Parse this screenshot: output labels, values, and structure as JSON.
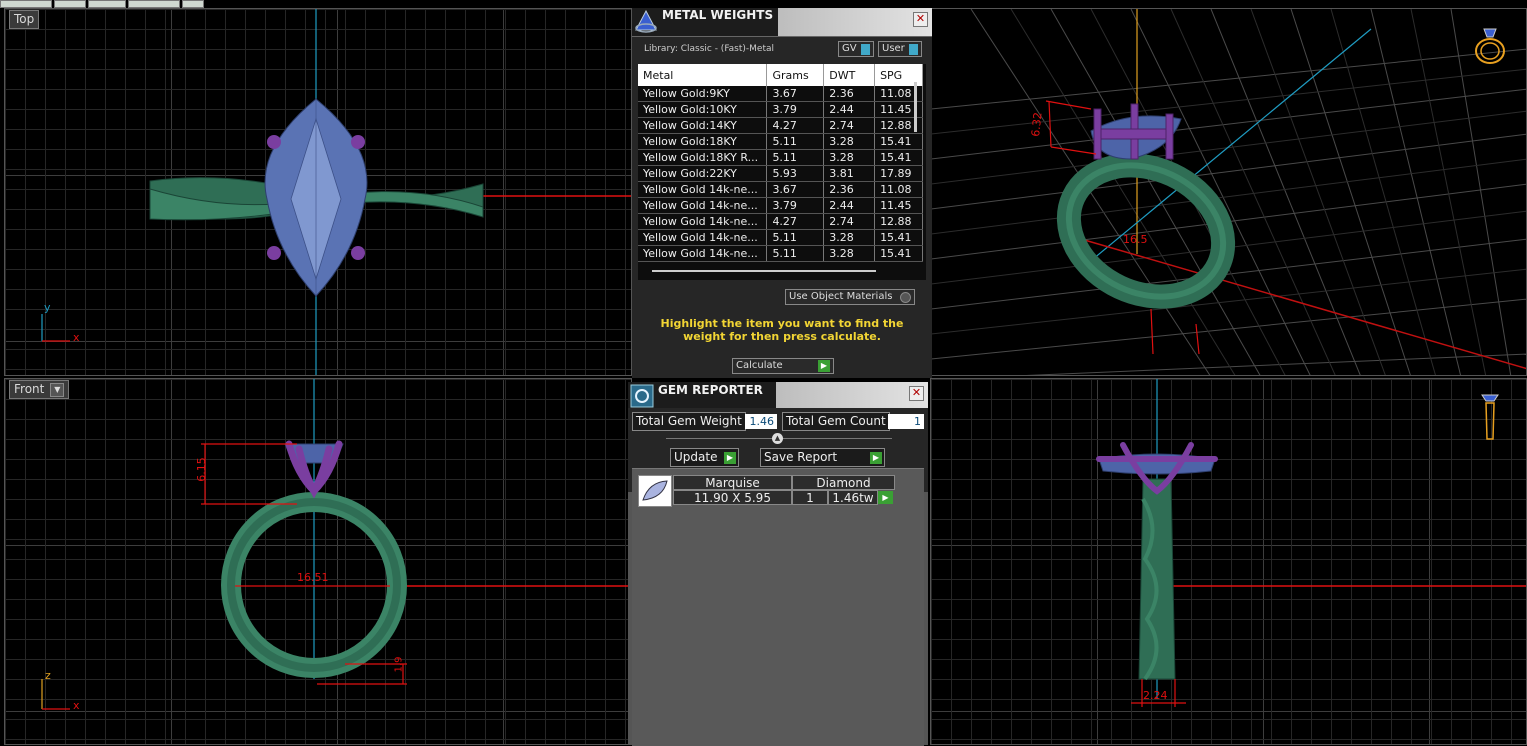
{
  "viewports": {
    "top": {
      "label": "Top"
    },
    "front": {
      "label": "Front"
    },
    "axes": {
      "top_y": "y",
      "top_x": "x",
      "front_z": "z",
      "front_x": "x"
    },
    "dimensions": {
      "perspective_height": "6.32",
      "perspective_ring": "16.5",
      "front_height": "6.15",
      "front_ring_diameter": "16.51",
      "front_band_thickness": "1.9",
      "right_band_width": "2.24"
    }
  },
  "metal_weights": {
    "title": "METAL WEIGHTS",
    "library": "Library: Classic - (Fast)-Metal",
    "gv_label": "GV",
    "user_label": "User",
    "columns": [
      "Metal",
      "Grams",
      "DWT",
      "SPG"
    ],
    "rows": [
      [
        "Yellow Gold:9KY",
        "3.67",
        "2.36",
        "11.08"
      ],
      [
        "Yellow Gold:10KY",
        "3.79",
        "2.44",
        "11.45"
      ],
      [
        "Yellow Gold:14KY",
        "4.27",
        "2.74",
        "12.88"
      ],
      [
        "Yellow Gold:18KY",
        "5.11",
        "3.28",
        "15.41"
      ],
      [
        "Yellow Gold:18KY R...",
        "5.11",
        "3.28",
        "15.41"
      ],
      [
        "Yellow Gold:22KY",
        "5.93",
        "3.81",
        "17.89"
      ],
      [
        "Yellow Gold 14k-ne...",
        "3.67",
        "2.36",
        "11.08"
      ],
      [
        "Yellow Gold 14k-ne...",
        "3.79",
        "2.44",
        "11.45"
      ],
      [
        "Yellow Gold 14k-ne...",
        "4.27",
        "2.74",
        "12.88"
      ],
      [
        "Yellow Gold 14k-ne...",
        "5.11",
        "3.28",
        "15.41"
      ],
      [
        "Yellow Gold 14k-ne...",
        "5.11",
        "3.28",
        "15.41"
      ]
    ],
    "use_object_materials": "Use Object Materials",
    "instruction": "Highlight the item you want to find the weight for then press calculate.",
    "calculate_label": "Calculate"
  },
  "gem_reporter": {
    "title": "GEM REPORTER",
    "total_weight_label": "Total Gem Weight",
    "total_weight_value": "1.46",
    "total_count_label": "Total Gem Count",
    "total_count_value": "1",
    "update_label": "Update",
    "save_report_label": "Save Report",
    "gem": {
      "shape": "Marquise",
      "type": "Diamond",
      "size": "11.90 X 5.95",
      "count": "1",
      "weight": "1.46tw"
    }
  },
  "colors": {
    "ring": "#2f6e55",
    "stone": "#5a73b4",
    "prongs": "#7a3ea0",
    "dim_red": "#e01010",
    "axis_blue": "#1f9cc2",
    "accent_yellow": "#f2d534"
  }
}
